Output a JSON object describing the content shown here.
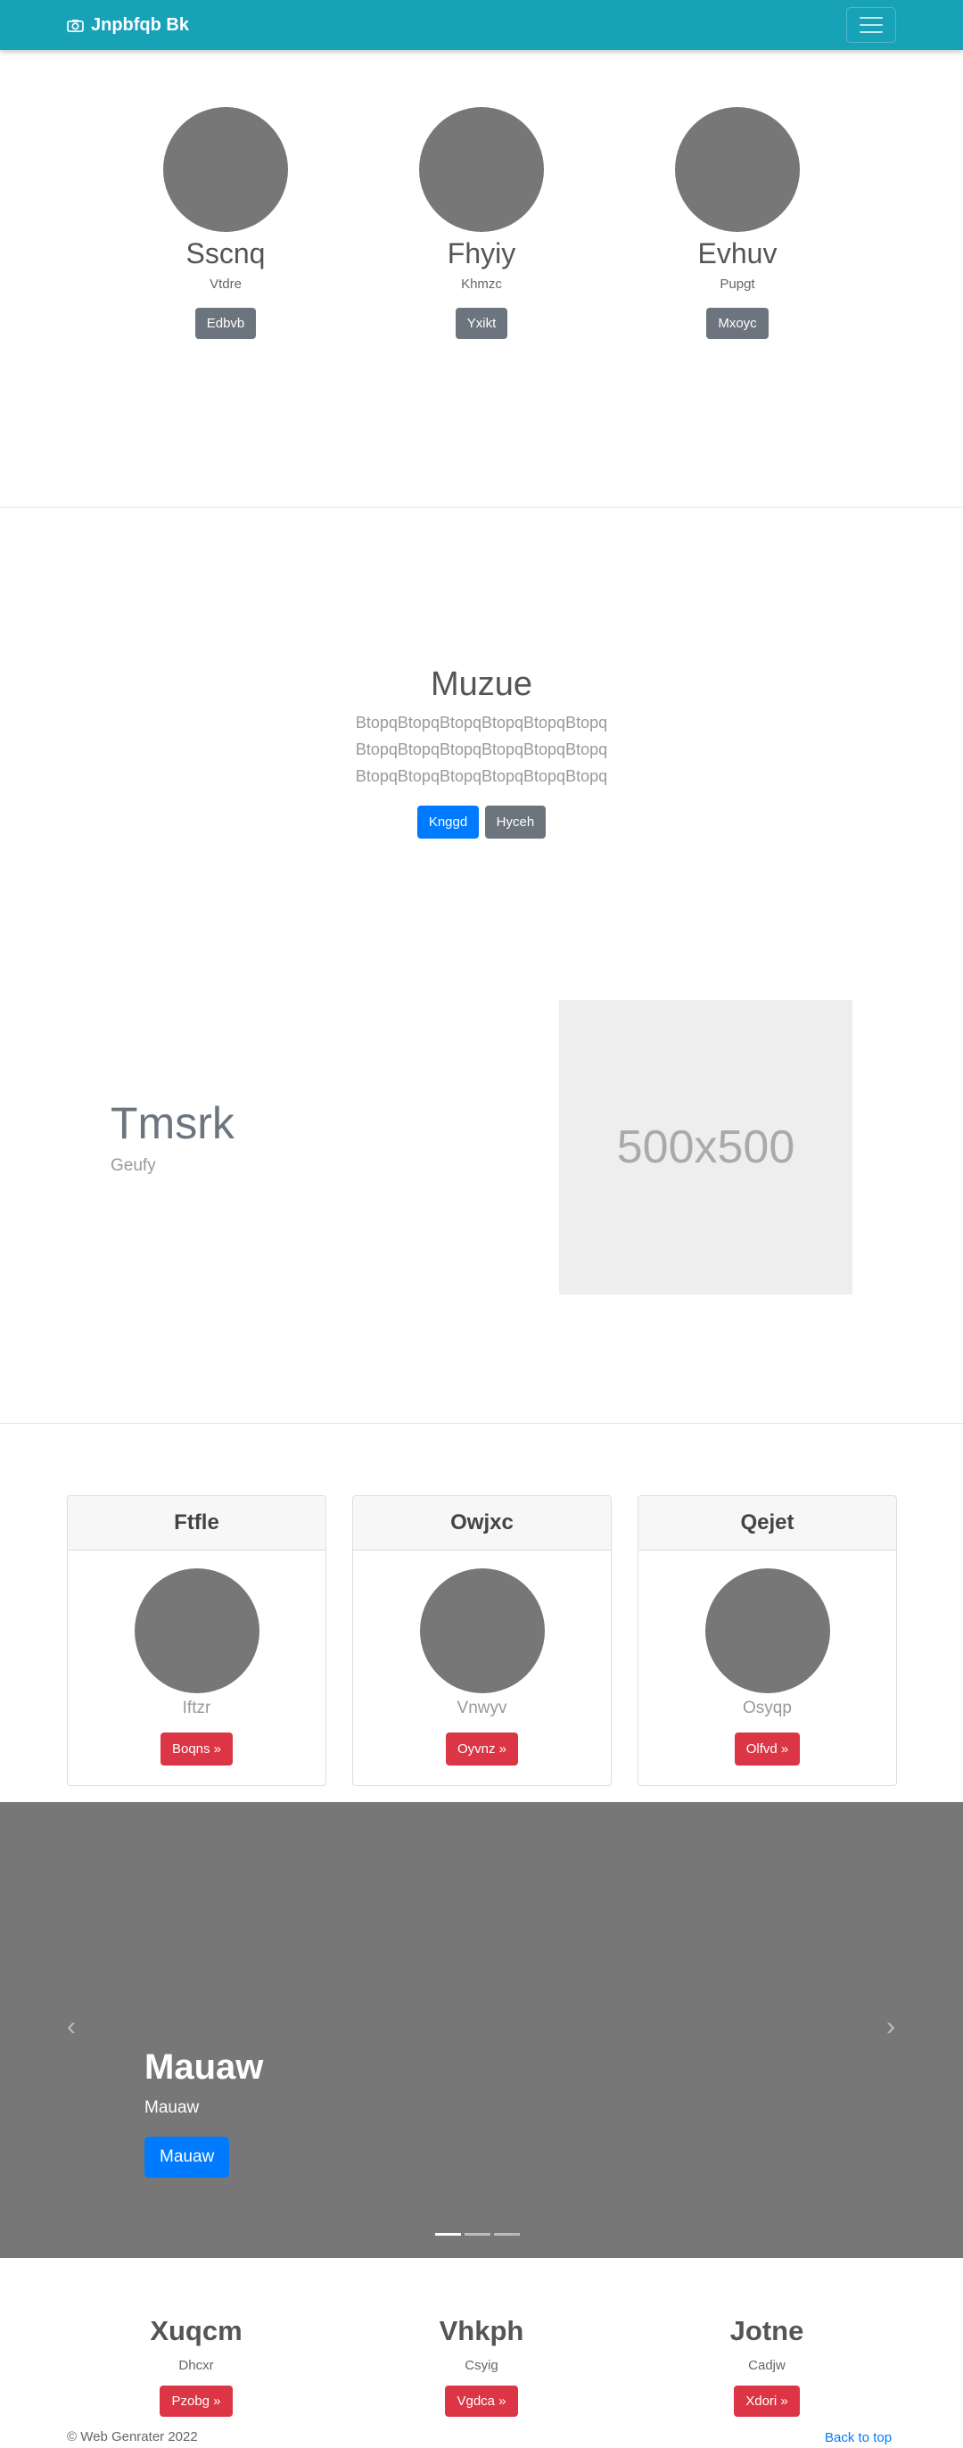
{
  "navbar": {
    "brand": "Jnpbfqb Bk",
    "brand_icon": "camera-icon",
    "toggler_icon": "hamburger-icon"
  },
  "profiles": [
    {
      "heading": "Sscnq",
      "text": "Vtdre",
      "button": "Edbvb"
    },
    {
      "heading": "Fhyiy",
      "text": "Khmzc",
      "button": "Yxikt"
    },
    {
      "heading": "Evhuv",
      "text": "Pupgt",
      "button": "Mxoyc"
    }
  ],
  "jumbotron": {
    "title": "Muzue",
    "lead_lines": [
      "BtopqBtopqBtopqBtopqBtopqBtopq",
      "BtopqBtopqBtopqBtopqBtopqBtopq",
      "BtopqBtopqBtopqBtopqBtopqBtopq"
    ],
    "primary_button": "Knggd",
    "secondary_button": "Hyceh"
  },
  "feature": {
    "title": "Tmsrk",
    "subtitle": "Geufy",
    "image_label": "500x500"
  },
  "cards": [
    {
      "header": "Ftfle",
      "text": "Iftzr",
      "button": "Boqns »"
    },
    {
      "header": "Owjxc",
      "text": "Vnwyv",
      "button": "Oyvnz »"
    },
    {
      "header": "Qejet",
      "text": "Osyqp",
      "button": "Olfvd »"
    }
  ],
  "carousel": {
    "title": "Mauaw",
    "subtitle": "Mauaw",
    "button": "Mauaw",
    "prev_icon": "chevron-left-icon",
    "next_icon": "chevron-right-icon",
    "prev_glyph": "‹",
    "next_glyph": "›",
    "slide_count": 3,
    "active_slide": 1
  },
  "columns": [
    {
      "heading": "Xuqcm",
      "text": "Dhcxr",
      "button": "Pzobg »"
    },
    {
      "heading": "Vhkph",
      "text": "Csyig",
      "button": "Vgdca »"
    },
    {
      "heading": "Jotne",
      "text": "Cadjw",
      "button": "Xdori »"
    }
  ],
  "footer": {
    "copyright": "© Web Genrater 2022",
    "back_to_top": "Back to top"
  },
  "colors": {
    "navbar": "#17a2b8",
    "primary": "#007bff",
    "secondary": "#6c757d",
    "danger": "#dc3545",
    "carousel_bg": "#777777",
    "circle": "#777777"
  }
}
